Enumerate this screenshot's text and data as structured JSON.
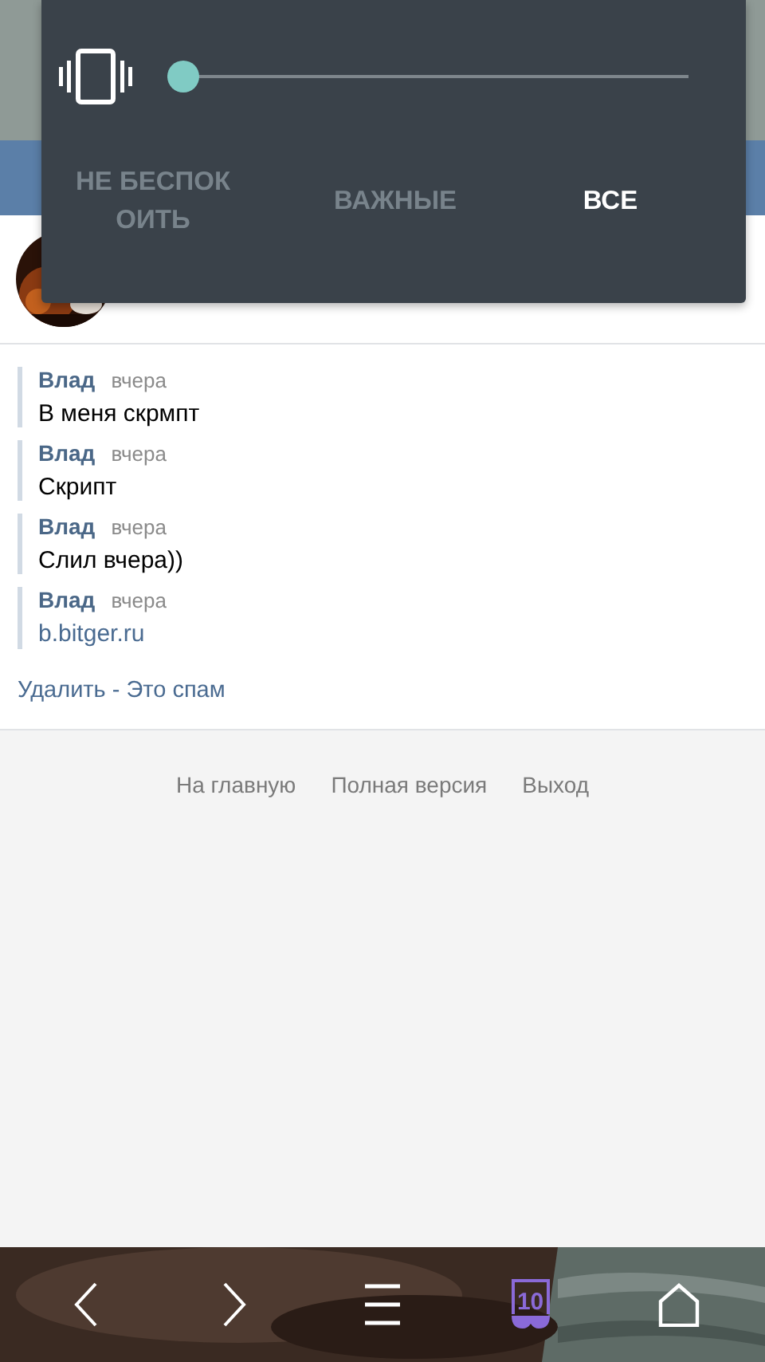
{
  "volume_panel": {
    "level": 0,
    "modes": [
      {
        "label": "НЕ БЕСПОКОИТЬ",
        "selected": false
      },
      {
        "label": "ВАЖНЫЕ",
        "selected": false
      },
      {
        "label": "ВСЕ",
        "selected": true
      }
    ]
  },
  "messages": [
    {
      "author": "Влад",
      "time": "вчера",
      "text": "В меня скрмпт",
      "kind": "text"
    },
    {
      "author": "Влад",
      "time": "вчера",
      "text": "Скрипт",
      "kind": "text"
    },
    {
      "author": "Влад",
      "time": "вчера",
      "text": "Слил вчера))",
      "kind": "text"
    },
    {
      "author": "Влад",
      "time": "вчера",
      "text": "b.bitger.ru",
      "kind": "link"
    }
  ],
  "actions": {
    "delete": "Удалить",
    "separator": "-",
    "spam": "Это спам"
  },
  "footer_links": [
    "На главную",
    "Полная версия",
    "Выход"
  ],
  "bottom_nav": {
    "tab_count": "10"
  }
}
